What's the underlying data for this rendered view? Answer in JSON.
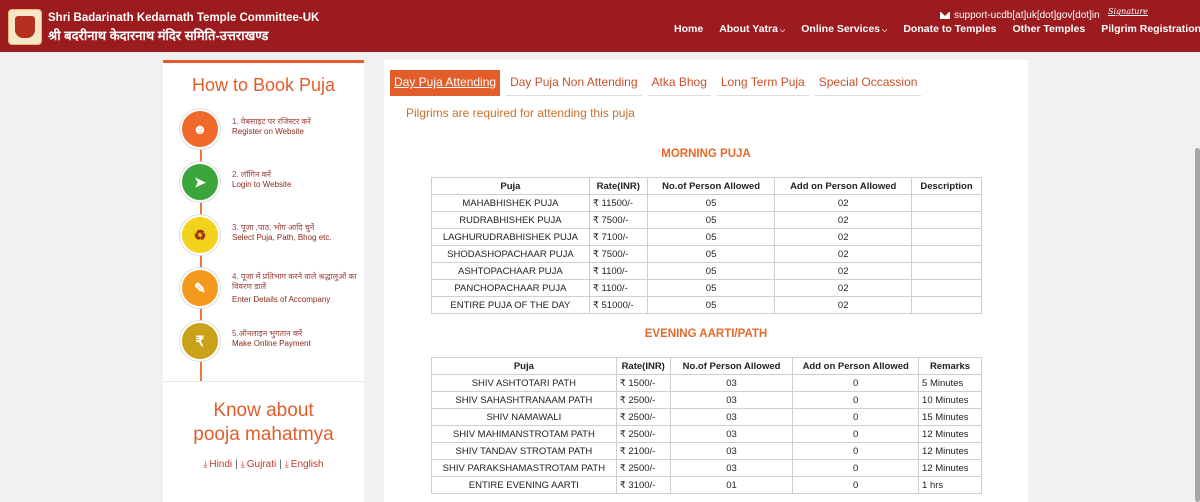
{
  "header": {
    "brand_en": "Shri Badarinath Kedarnath Temple Committee-UK",
    "brand_hi": "श्री बदरीनाथ केदारनाथ मंदिर समिति-उत्तराखण्ड",
    "support_email": "support-ucdb[at]uk[dot]gov[dot]in",
    "signature": "Signature",
    "nav": [
      {
        "label": "Home",
        "dropdown": false
      },
      {
        "label": "About Yatra",
        "dropdown": true
      },
      {
        "label": "Online Services",
        "dropdown": true
      },
      {
        "label": "Donate to Temples",
        "dropdown": false
      },
      {
        "label": "Other Temples",
        "dropdown": false
      },
      {
        "label": "Pilgrim Registration/Login",
        "dropdown": false
      }
    ]
  },
  "left": {
    "title": "How to Book Puja",
    "steps": [
      {
        "hi": "1. वेबसाइट पर रजिस्टर करें",
        "en": "Register on Website",
        "color": "#ef6a2a",
        "icon": "user-add-icon"
      },
      {
        "hi": "2. लॉगिन करें",
        "en": "Login to Website",
        "color": "#3aa53a",
        "icon": "login-icon"
      },
      {
        "hi": "3. पूजा ,पाठ, भोग आदि चुनें",
        "en": "Select Puja, Path, Bhog etc.",
        "color": "#f2d21a",
        "icon": "kalash-icon"
      },
      {
        "hi": "4. पूजा में प्रतिभाग करने वाले श्रद्धालुओं का विवरण डालें",
        "en": "Enter Details of Accompany",
        "color": "#f39a1e",
        "icon": "edit-icon"
      },
      {
        "hi": "5.ऑनलाइन भुगतान करें",
        "en": "Make Online Payment",
        "color": "#c9a21a",
        "icon": "money-bag-icon"
      }
    ],
    "know_line1": "Know about",
    "know_line2": "pooja mahatmya",
    "langs": [
      "Hindi",
      "Gujrati",
      "English"
    ]
  },
  "tabs": [
    "Day Puja Attending",
    "Day Puja Non Attending",
    "Atka Bhog",
    "Long Term Puja",
    "Special Occassion"
  ],
  "notice": "Pilgrims are required for attending this puja",
  "morning": {
    "title": "MORNING PUJA",
    "headers": [
      "Puja",
      "Rate(INR)",
      "No.of Person Allowed",
      "Add on Person Allowed",
      "Description"
    ],
    "rows": [
      [
        "MAHABHISHEK PUJA",
        "₹ 11500/-",
        "05",
        "02",
        ""
      ],
      [
        "RUDRABHISHEK PUJA",
        "₹ 7500/-",
        "05",
        "02",
        ""
      ],
      [
        "LAGHURUDRABHISHEK PUJA",
        "₹ 7100/-",
        "05",
        "02",
        ""
      ],
      [
        "SHODASHOPACHAAR PUJA",
        "₹ 7500/-",
        "05",
        "02",
        ""
      ],
      [
        "ASHTOPACHAAR PUJA",
        "₹ 1100/-",
        "05",
        "02",
        ""
      ],
      [
        "PANCHOPACHAAR PUJA",
        "₹ 1100/-",
        "05",
        "02",
        ""
      ],
      [
        "ENTIRE PUJA OF THE DAY",
        "₹ 51000/-",
        "05",
        "02",
        ""
      ]
    ]
  },
  "evening": {
    "title": "EVENING AARTI/PATH",
    "headers": [
      "Puja",
      "Rate(INR)",
      "No.of Person Allowed",
      "Add on Person Allowed",
      "Remarks"
    ],
    "rows": [
      [
        "SHIV ASHTOTARI PATH",
        "₹ 1500/-",
        "03",
        "0",
        "5 Minutes"
      ],
      [
        "SHIV SAHASHTRANAAM PATH",
        "₹ 2500/-",
        "03",
        "0",
        "10 Minutes"
      ],
      [
        "SHIV NAMAWALI",
        "₹ 2500/-",
        "03",
        "0",
        "15 Minutes"
      ],
      [
        "SHIV MAHIMANSTROTAM PATH",
        "₹ 2500/-",
        "03",
        "0",
        "12 Minutes"
      ],
      [
        "SHIV TANDAV STROTAM PATH",
        "₹ 2100/-",
        "03",
        "0",
        "12 Minutes"
      ],
      [
        "SHIV PARAKSHAMASTROTAM PATH",
        "₹ 2500/-",
        "03",
        "0",
        "12 Minutes"
      ],
      [
        "ENTIRE EVENING AARTI",
        "₹ 3100/-",
        "01",
        "0",
        "1 hrs"
      ]
    ]
  },
  "colors": {
    "header_bg": "#9b1b1f",
    "accent": "#e35d2a"
  }
}
